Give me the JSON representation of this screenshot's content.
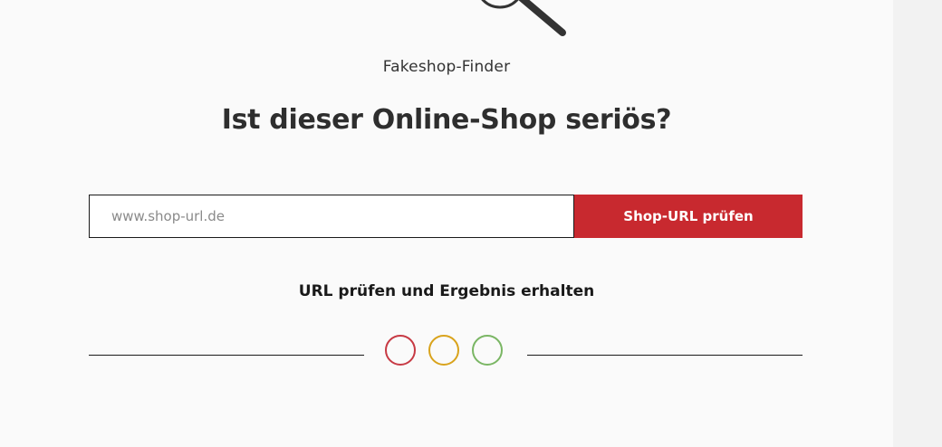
{
  "tool_name": "Fakeshop-Finder",
  "headline": "Ist dieser Online-Shop seriös?",
  "form": {
    "url_placeholder": "www.shop-url.de",
    "url_value": "",
    "submit_label": "Shop-URL prüfen"
  },
  "subheading": "URL prüfen und Ergebnis erhalten",
  "icons": {
    "hero": "magnifier-icon",
    "indicators": [
      "red-circle-icon",
      "yellow-circle-icon",
      "green-circle-icon"
    ]
  },
  "colors": {
    "accent": "#c8292f",
    "indicator_red": "#c73a44",
    "indicator_yellow": "#d9a31c",
    "indicator_green": "#7ab664"
  }
}
